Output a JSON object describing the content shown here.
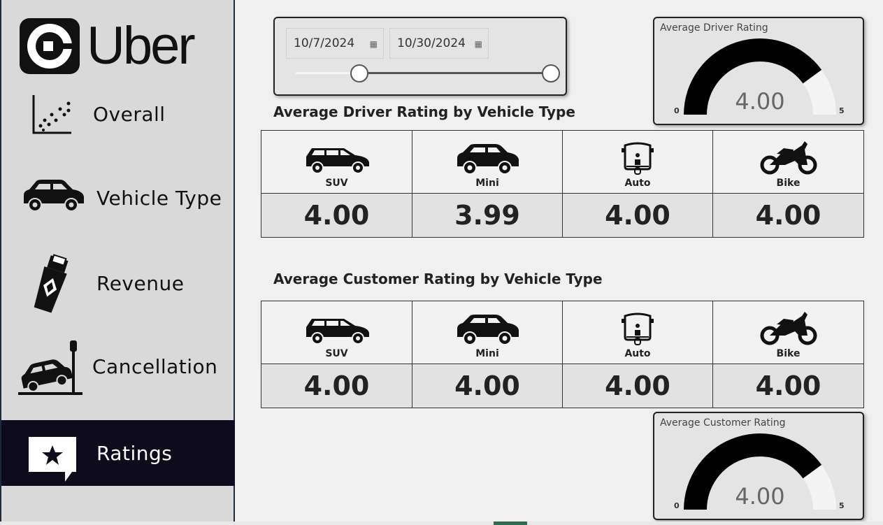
{
  "brand": {
    "name": "Uber"
  },
  "nav": {
    "items": [
      {
        "label": "Overall",
        "icon": "scatter-plot-icon"
      },
      {
        "label": "Vehicle Type",
        "icon": "car-icon"
      },
      {
        "label": "Revenue",
        "icon": "cash-icon"
      },
      {
        "label": "Cancellation",
        "icon": "car-crash-icon"
      },
      {
        "label": "Ratings",
        "icon": "star-bubble-icon",
        "active": true
      }
    ]
  },
  "date_filter": {
    "start": "10/7/2024",
    "end": "10/30/2024",
    "range_start_fraction": 0.25,
    "range_end_fraction": 1.0
  },
  "driver_gauge": {
    "title": "Average Driver Rating",
    "value": "4.00",
    "numeric_value": 4.0,
    "min": "0",
    "max": "5"
  },
  "customer_gauge": {
    "title": "Average Customer Rating",
    "value": "4.00",
    "numeric_value": 4.0,
    "min": "0",
    "max": "5"
  },
  "driver_table": {
    "title": "Average Driver Rating by Vehicle Type",
    "vehicles": [
      {
        "label": "SUV",
        "value": "4.00",
        "icon": "suv-icon"
      },
      {
        "label": "Mini",
        "value": "3.99",
        "icon": "mini-car-icon"
      },
      {
        "label": "Auto",
        "value": "4.00",
        "icon": "auto-rickshaw-icon"
      },
      {
        "label": "Bike",
        "value": "4.00",
        "icon": "motorbike-icon"
      }
    ]
  },
  "customer_table": {
    "title": "Average Customer Rating by Vehicle Type",
    "vehicles": [
      {
        "label": "SUV",
        "value": "4.00",
        "icon": "suv-icon"
      },
      {
        "label": "Mini",
        "value": "4.00",
        "icon": "mini-car-icon"
      },
      {
        "label": "Auto",
        "value": "4.00",
        "icon": "auto-rickshaw-icon"
      },
      {
        "label": "Bike",
        "value": "4.00",
        "icon": "motorbike-icon"
      }
    ]
  },
  "colors": {
    "sidebar_bg": "#d9d9d9",
    "active_nav_bg": "#0e0c1c",
    "gauge_fill": "#000000",
    "gauge_track": "#f4f4f4"
  }
}
